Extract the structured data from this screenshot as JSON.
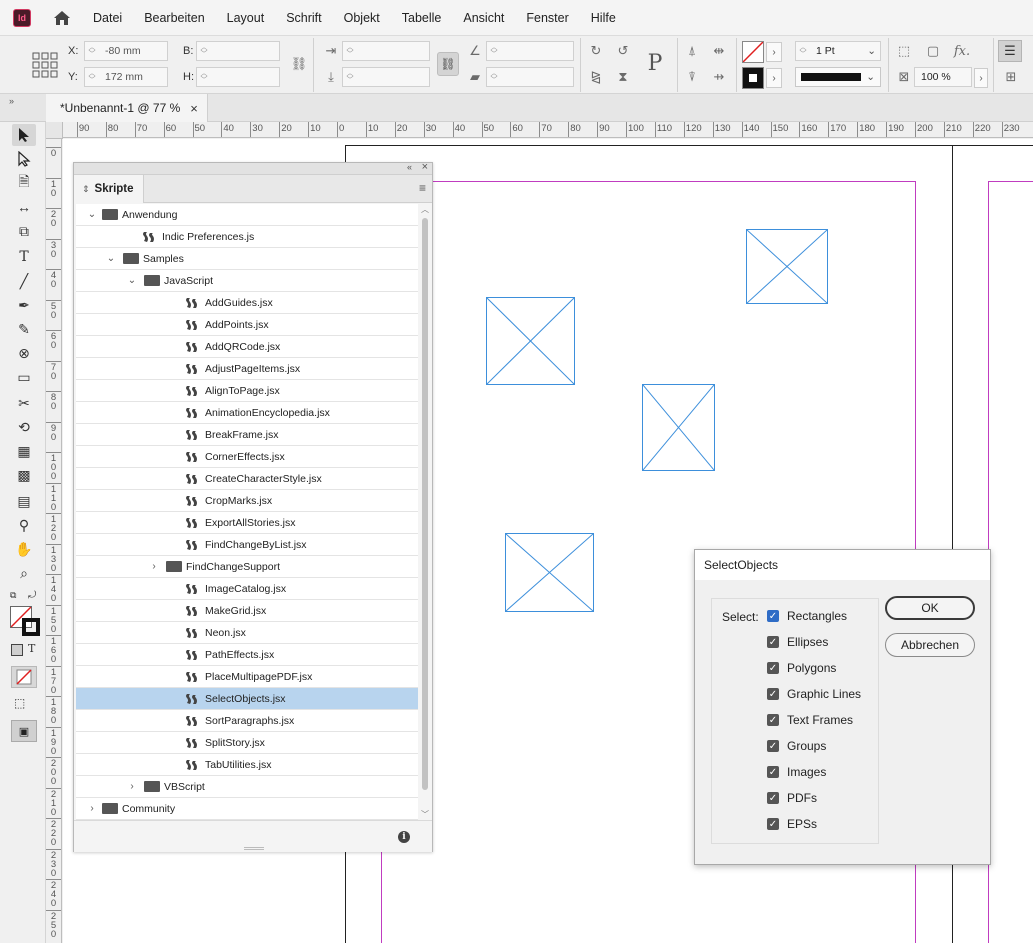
{
  "app": {
    "logo_text": "Id"
  },
  "menu": [
    "Datei",
    "Bearbeiten",
    "Layout",
    "Schrift",
    "Objekt",
    "Tabelle",
    "Ansicht",
    "Fenster",
    "Hilfe"
  ],
  "control": {
    "x_label": "X:",
    "x_value": "-80 mm",
    "y_label": "Y:",
    "y_value": "172 mm",
    "b_label": "B:",
    "h_label": "H:",
    "stroke_weight": "1 Pt",
    "scale": "100 %",
    "fx": "fx."
  },
  "document_tab": {
    "title": "*Unbenannt-1 @ 77 %",
    "close": "×"
  },
  "ruler_top": [
    "00",
    "90",
    "80",
    "70",
    "60",
    "50",
    "40",
    "30",
    "20",
    "10",
    "0",
    "10",
    "20",
    "30",
    "40",
    "50",
    "60",
    "70",
    "80",
    "90",
    "100",
    "110",
    "120",
    "130",
    "140",
    "150",
    "160",
    "170",
    "180",
    "190",
    "200",
    "210",
    "220",
    "230"
  ],
  "ruler_left": [
    "0",
    "1 0",
    "2 0",
    "3 0",
    "4 0",
    "5 0",
    "6 0",
    "7 0",
    "8 0",
    "9 0",
    "1 0 0",
    "1 1 0",
    "1 2 0",
    "1 3 0",
    "1 4 0",
    "1 5 0",
    "1 6 0",
    "1 7 0",
    "1 8 0",
    "1 9 0",
    "2 0 0",
    "2 1 0",
    "2 2 0",
    "2 3 0",
    "2 4 0",
    "2 5 0"
  ],
  "scripts_panel": {
    "tab_label": "Skripte",
    "items": [
      {
        "label": "Anwendung",
        "type": "folder",
        "level": 0,
        "expanded": true
      },
      {
        "label": "Indic Preferences.js",
        "type": "script",
        "level": 1
      },
      {
        "label": "Samples",
        "type": "folder",
        "level": 1,
        "expanded": true
      },
      {
        "label": "JavaScript",
        "type": "folder",
        "level": 2,
        "expanded": true
      },
      {
        "label": "AddGuides.jsx",
        "type": "script",
        "level": 3
      },
      {
        "label": "AddPoints.jsx",
        "type": "script",
        "level": 3
      },
      {
        "label": "AddQRCode.jsx",
        "type": "script",
        "level": 3
      },
      {
        "label": "AdjustPageItems.jsx",
        "type": "script",
        "level": 3
      },
      {
        "label": "AlignToPage.jsx",
        "type": "script",
        "level": 3
      },
      {
        "label": "AnimationEncyclopedia.jsx",
        "type": "script",
        "level": 3
      },
      {
        "label": "BreakFrame.jsx",
        "type": "script",
        "level": 3
      },
      {
        "label": "CornerEffects.jsx",
        "type": "script",
        "level": 3
      },
      {
        "label": "CreateCharacterStyle.jsx",
        "type": "script",
        "level": 3
      },
      {
        "label": "CropMarks.jsx",
        "type": "script",
        "level": 3
      },
      {
        "label": "ExportAllStories.jsx",
        "type": "script",
        "level": 3
      },
      {
        "label": "FindChangeByList.jsx",
        "type": "script",
        "level": 3
      },
      {
        "label": "FindChangeSupport",
        "type": "folder",
        "level": 3,
        "expanded": false
      },
      {
        "label": "ImageCatalog.jsx",
        "type": "script",
        "level": 3
      },
      {
        "label": "MakeGrid.jsx",
        "type": "script",
        "level": 3
      },
      {
        "label": "Neon.jsx",
        "type": "script",
        "level": 3
      },
      {
        "label": "PathEffects.jsx",
        "type": "script",
        "level": 3
      },
      {
        "label": "PlaceMultipagePDF.jsx",
        "type": "script",
        "level": 3
      },
      {
        "label": "SelectObjects.jsx",
        "type": "script",
        "level": 3,
        "selected": true
      },
      {
        "label": "SortParagraphs.jsx",
        "type": "script",
        "level": 3
      },
      {
        "label": "SplitStory.jsx",
        "type": "script",
        "level": 3
      },
      {
        "label": "TabUtilities.jsx",
        "type": "script",
        "level": 3
      },
      {
        "label": "VBScript",
        "type": "folder",
        "level": 2,
        "expanded": false
      },
      {
        "label": "Community",
        "type": "folder",
        "level": 0,
        "expanded": false
      }
    ]
  },
  "dialog": {
    "title": "SelectObjects",
    "select_label": "Select:",
    "options": [
      "Rectangles",
      "Ellipses",
      "Polygons",
      "Graphic Lines",
      "Text Frames",
      "Groups",
      "Images",
      "PDFs",
      "EPSs"
    ],
    "ok": "OK",
    "cancel": "Abbrechen"
  },
  "colors": {
    "selection": "#b8d4ee",
    "frame": "#3d8fdb",
    "margin": "#c03cc0",
    "checkbox": "#2f6cc6"
  }
}
